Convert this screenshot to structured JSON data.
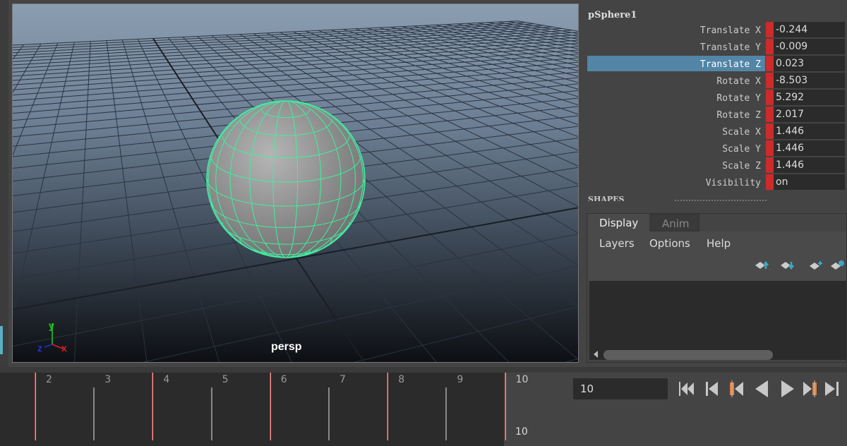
{
  "viewport": {
    "camera_label": "persp",
    "axis": {
      "x": "x",
      "y": "y",
      "z": "z"
    },
    "colors": {
      "wireframe": "#3cf0a0",
      "axis_x": "#e02020",
      "axis_y": "#20d020",
      "axis_z": "#2030e0"
    }
  },
  "channel_box": {
    "object_name": "pSphere1",
    "channels": [
      {
        "label": "Translate X",
        "value": "-0.244"
      },
      {
        "label": "Translate Y",
        "value": "-0.009"
      },
      {
        "label": "Translate Z",
        "value": "0.023",
        "selected": true
      },
      {
        "label": "Rotate X",
        "value": "-8.503"
      },
      {
        "label": "Rotate Y",
        "value": "5.292"
      },
      {
        "label": "Rotate Z",
        "value": "2.017"
      },
      {
        "label": "Scale X",
        "value": "1.446"
      },
      {
        "label": "Scale Y",
        "value": "1.446"
      },
      {
        "label": "Scale Z",
        "value": "1.446"
      },
      {
        "label": "Visibility",
        "value": "on"
      }
    ],
    "shapes_label": "SHAPES"
  },
  "layer_editor": {
    "tabs": [
      {
        "label": "Display",
        "active": true
      },
      {
        "label": "Anim",
        "active": false
      }
    ],
    "menu": [
      "Layers",
      "Options",
      "Help"
    ],
    "icons": [
      "move-layer-up-icon",
      "move-layer-down-icon",
      "new-layer-icon",
      "new-layer-selected-icon"
    ]
  },
  "timeline": {
    "frames": [
      "2",
      "3",
      "4",
      "5",
      "6",
      "7",
      "8",
      "9",
      "10"
    ],
    "keyframes": [
      "2",
      "4",
      "6",
      "8",
      "10"
    ],
    "current_frame": "10"
  },
  "playback": {
    "current_frame_field": "10",
    "buttons": [
      "go-to-start",
      "step-back-frame",
      "step-back-key",
      "play-backwards",
      "play-forwards",
      "step-forward-key",
      "step-forward-frame"
    ]
  }
}
